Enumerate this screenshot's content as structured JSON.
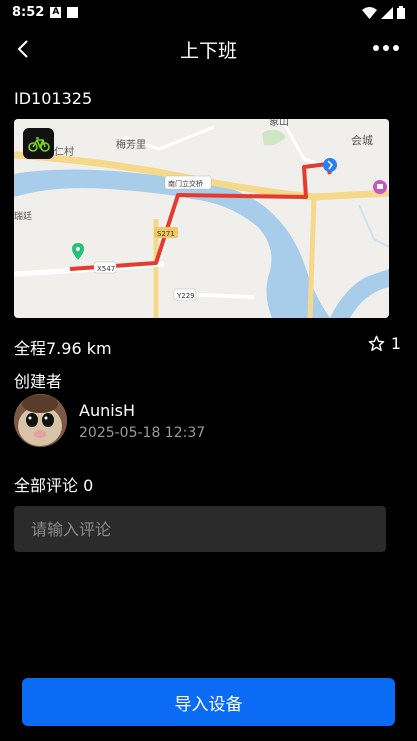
{
  "status_bar": {
    "time": "8:52",
    "notif_letter": "A"
  },
  "header": {
    "title": "上下班"
  },
  "route": {
    "id": "ID101325",
    "distance": "全程7.96 km",
    "favorites": "1"
  },
  "map_labels": {
    "xiang_shan": "象山",
    "hui_cheng": "会城",
    "mei_fang_li": "梅芳里",
    "ren_cun": "兴仁村",
    "bridge": "南门立交桥",
    "s271": "S271",
    "x547": "X547",
    "y229": "Y229",
    "left_edge": "瑞廷"
  },
  "creator": {
    "label": "创建者",
    "name": "AunisH",
    "date": "2025-05-18 12:37"
  },
  "comments": {
    "label": "全部评论 0",
    "placeholder": "请输入评论"
  },
  "action": {
    "import_label": "导入设备"
  },
  "colors": {
    "accent": "#0a6cf5",
    "route": "#e33b2e",
    "background": "#000000"
  }
}
